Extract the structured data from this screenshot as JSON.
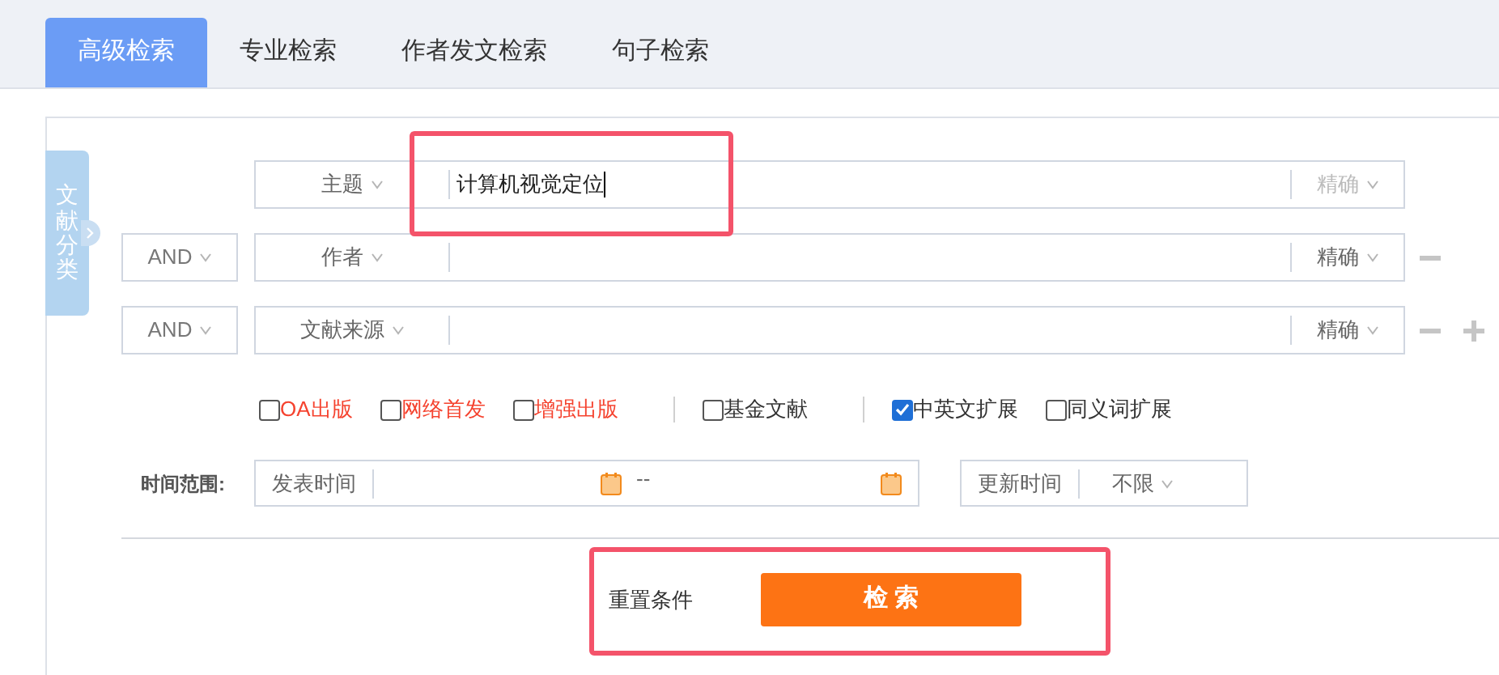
{
  "tabs": [
    {
      "label": "高级检索",
      "selected": true
    },
    {
      "label": "专业检索",
      "selected": false
    },
    {
      "label": "作者发文检索",
      "selected": false
    },
    {
      "label": "句子检索",
      "selected": false
    }
  ],
  "side_tab": {
    "label": "文献分类"
  },
  "search_rows": [
    {
      "field": "主题",
      "value": "计算机视觉定位",
      "match": "精确",
      "match_disabled": true,
      "remove": false,
      "add": false
    },
    {
      "operator": "AND",
      "field": "作者",
      "match": "精确",
      "match_disabled": false,
      "remove": true,
      "add": false
    },
    {
      "operator": "AND",
      "field": "文献来源",
      "match": "精确",
      "match_disabled": false,
      "remove": true,
      "add": true
    }
  ],
  "options": [
    {
      "kind": "checkbox",
      "label": "OA出版",
      "checked": false,
      "color": "#f5432f"
    },
    {
      "kind": "checkbox",
      "label": "网络首发",
      "checked": false,
      "color": "#f5432f"
    },
    {
      "kind": "checkbox",
      "label": "增强出版",
      "checked": false,
      "color": "#f5432f"
    },
    {
      "kind": "separator"
    },
    {
      "kind": "checkbox",
      "label": "基金文献",
      "checked": false,
      "color": "#333333"
    },
    {
      "kind": "separator"
    },
    {
      "kind": "checkbox",
      "label": "中英文扩展",
      "checked": true,
      "color": "#333333"
    },
    {
      "kind": "checkbox",
      "label": "同义词扩展",
      "checked": false,
      "color": "#333333"
    }
  ],
  "time_range": {
    "label": "时间范围:",
    "publish_label": "发表时间",
    "separator": "--",
    "update_label": "更新时间",
    "update_value": "不限"
  },
  "reset": "重置条件",
  "search_button": "检 索"
}
